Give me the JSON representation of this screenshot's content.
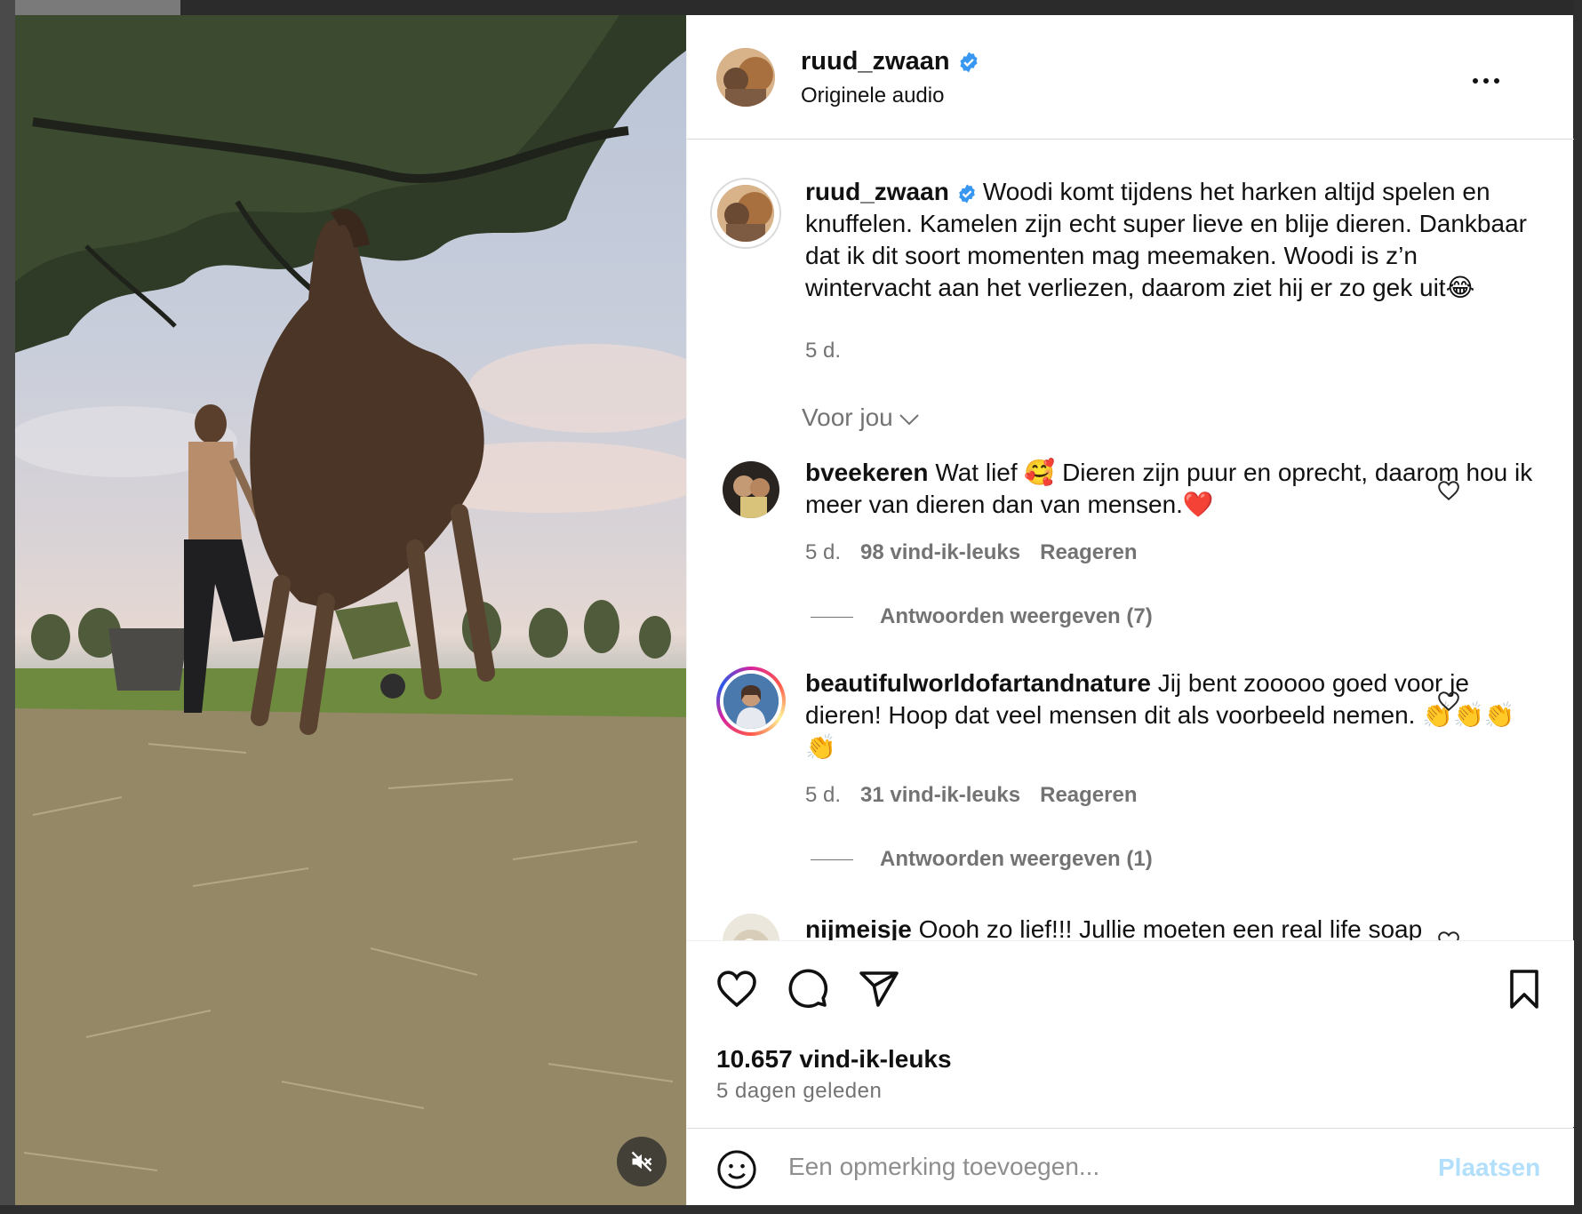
{
  "post": {
    "author": "ruud_zwaan",
    "audio_label": "Originele audio"
  },
  "caption": {
    "username": "ruud_zwaan",
    "text": "Woodi komt tijdens het harken altijd spelen en knuffelen. Kamelen zijn echt super lieve en blije dieren. Dankbaar dat ik dit soort momenten mag meemaken. Woodi is z’n wintervacht aan het verliezen, daarom ziet hij er zo gek uit😂",
    "time": "5 d."
  },
  "sort_label": "Voor jou",
  "comments": [
    {
      "username": "bveekeren",
      "text": "Wat lief 🥰 Dieren zijn puur en oprecht, daarom hou ik meer van dieren dan van mensen.❤️",
      "time": "5 d.",
      "likes": "98 vind-ik-leuks",
      "reply_label": "Reageren",
      "view_replies": "Antwoorden weergeven (7)"
    },
    {
      "username": "beautifulworldofartandnature",
      "text": "Jij bent zooooo goed voor je dieren! Hoop dat veel mensen dit als voorbeeld nemen. 👏👏👏👏",
      "time": "5 d.",
      "likes": "31 vind-ik-leuks",
      "reply_label": "Reageren",
      "view_replies": "Antwoorden weergeven (1)"
    },
    {
      "username": "nijmeisje",
      "text": "Oooh zo lief!!! Jullie moeten een real life soap"
    }
  ],
  "stats": {
    "likes": "10.657 vind-ik-leuks",
    "date": "5 dagen geleden"
  },
  "composer": {
    "placeholder": "Een opmerking toevoegen...",
    "post_label": "Plaatsen"
  },
  "icons": {
    "verified": "verified-badge-icon",
    "more": "more-options-icon",
    "like": "heart-icon",
    "comment": "comment-bubble-icon",
    "share": "paper-plane-icon",
    "save": "bookmark-icon",
    "emoji": "emoji-icon",
    "mute": "muted-speaker-icon"
  },
  "colors": {
    "verified": "#3897f0",
    "link_blue_disabled": "#b2dffc",
    "secondary_text": "#737373"
  }
}
